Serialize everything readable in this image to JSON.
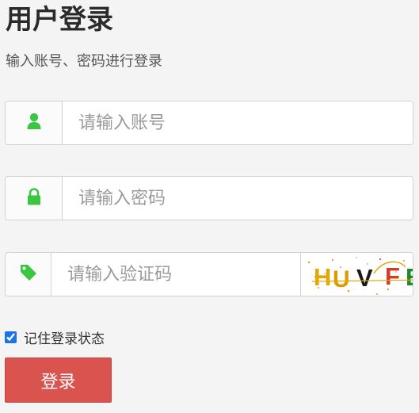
{
  "header": {
    "title": "用户登录",
    "subtitle": "输入账号、密码进行登录"
  },
  "form": {
    "account_placeholder": "请输入账号",
    "password_placeholder": "请输入密码",
    "captcha_placeholder": "请输入验证码",
    "captcha_text": "HUVFE",
    "remember_label": "记住登录状态",
    "remember_checked": true,
    "login_label": "登录"
  },
  "icons": {
    "account": "user-icon",
    "password": "lock-icon",
    "captcha": "tag-icon"
  },
  "colors": {
    "icon_green": "#3ac640",
    "login_button": "#d9534f",
    "background": "#f4f4f4"
  }
}
